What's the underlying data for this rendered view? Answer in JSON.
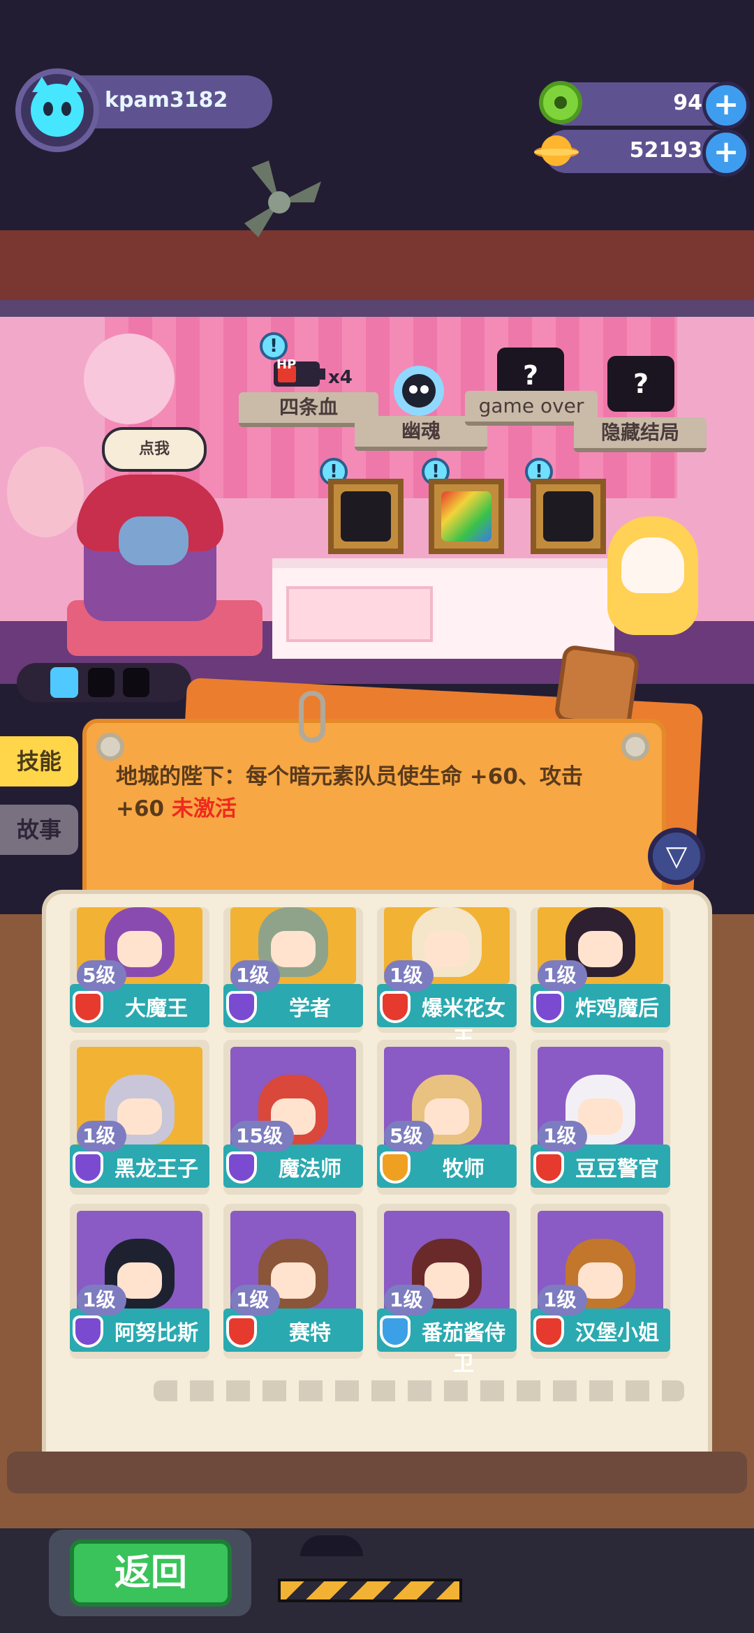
{
  "player": {
    "name": "kpam3182",
    "avatar_icon": "cat-face-icon"
  },
  "currency": {
    "gems": {
      "value": "94",
      "icon": "green-donut-gem-icon"
    },
    "coins": {
      "value": "52193",
      "icon": "planet-coin-icon"
    }
  },
  "scene": {
    "speech_bubble": "点我",
    "collectibles": [
      {
        "label": "四条血",
        "badge_text": "HP",
        "multiplier": "x4"
      },
      {
        "label": "幽魂"
      },
      {
        "label": "game over",
        "badge_text": "?"
      },
      {
        "label": "隐藏结局",
        "badge_text": "?"
      }
    ]
  },
  "tabs": {
    "skill": "技能",
    "story": "故事"
  },
  "skill_panel": {
    "description": "地城的陛下：每个暗元素队员使生命 +60、攻击 +60",
    "status": "未激活",
    "status_color": "#ee2a1f"
  },
  "filter_icon": "filter-funnel-icon",
  "heroes": [
    {
      "level": "5级",
      "name": "大魔王",
      "shield_color": "#e63a2e",
      "art_color": "#8a4bb0",
      "bg": "#f2b233"
    },
    {
      "level": "1级",
      "name": "学者",
      "shield_color": "#7a4bd0",
      "art_color": "#8fa38a",
      "bg": "#f2b233"
    },
    {
      "level": "1级",
      "name": "爆米花女王",
      "shield_color": "#e63a2e",
      "art_color": "#f5e6c9",
      "bg": "#f2b233"
    },
    {
      "level": "1级",
      "name": "炸鸡魔后",
      "shield_color": "#7a4bd0",
      "art_color": "#2e2030",
      "bg": "#f2b233"
    },
    {
      "level": "1级",
      "name": "黑龙王子",
      "shield_color": "#7a4bd0",
      "art_color": "#c8c6d8",
      "bg": "#f2b233"
    },
    {
      "level": "15级",
      "name": "魔法师",
      "shield_color": "#7a4bd0",
      "art_color": "#d9483a",
      "bg": "#8a5bc4"
    },
    {
      "level": "5级",
      "name": "牧师",
      "shield_color": "#f0a020",
      "art_color": "#e9c281",
      "bg": "#8a5bc4"
    },
    {
      "level": "1级",
      "name": "豆豆警官",
      "shield_color": "#e63a2e",
      "art_color": "#f2f0f4",
      "bg": "#8a5bc4"
    },
    {
      "level": "1级",
      "name": "阿努比斯",
      "shield_color": "#7a4bd0",
      "art_color": "#1e2230",
      "bg": "#8a5bc4"
    },
    {
      "level": "1级",
      "name": "赛特",
      "shield_color": "#e63a2e",
      "art_color": "#8a5538",
      "bg": "#8a5bc4"
    },
    {
      "level": "1级",
      "name": "番茄酱侍卫",
      "shield_color": "#3ca0e6",
      "art_color": "#6a2a2a",
      "bg": "#8a5bc4"
    },
    {
      "level": "1级",
      "name": "汉堡小姐",
      "shield_color": "#e63a2e",
      "art_color": "#c2772c",
      "bg": "#8a5bc4"
    }
  ],
  "bottom": {
    "back_label": "返回"
  }
}
